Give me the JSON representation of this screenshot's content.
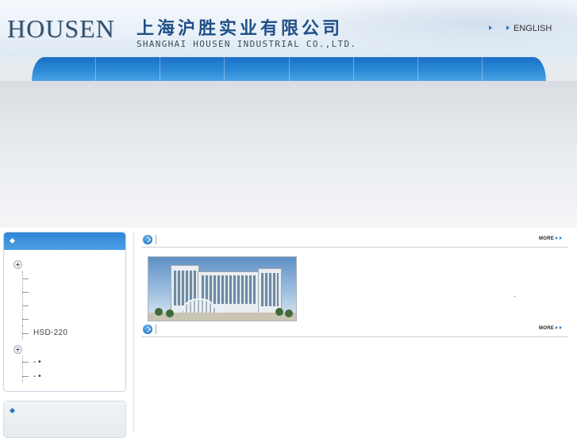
{
  "header": {
    "logo_en": "HOUSEN",
    "logo_cn": "上海沪胜实业有限公司",
    "logo_sub": "SHANGHAI HOUSEN INDUSTRIAL CO.,LTD.",
    "lang_primary": "",
    "lang_english": "ENGLISH"
  },
  "nav": {
    "items": [
      "",
      "",
      "",
      "",
      "",
      "",
      "",
      ""
    ]
  },
  "sidebar": {
    "box1_title": "",
    "tree_items": [
      "",
      "",
      "",
      "",
      ""
    ],
    "product_item": "HSD-220",
    "sub_items": [
      "- •",
      "- •"
    ],
    "box2_title": ""
  },
  "main": {
    "section1_title": "",
    "section1_more": "MORE",
    "section1_dash": "-",
    "section2_title": "",
    "section2_more": "MORE"
  },
  "icons": {
    "lang_arrow": "triangle-right-icon",
    "section": "circle-arrow-icon",
    "tree_toggle": "plus-circle-icon",
    "box_title": "diamond-icon"
  },
  "colors": {
    "brand_blue": "#2b8ad6",
    "logo_blue": "#1f4f86",
    "accent_arrow": "#2a77c0"
  }
}
